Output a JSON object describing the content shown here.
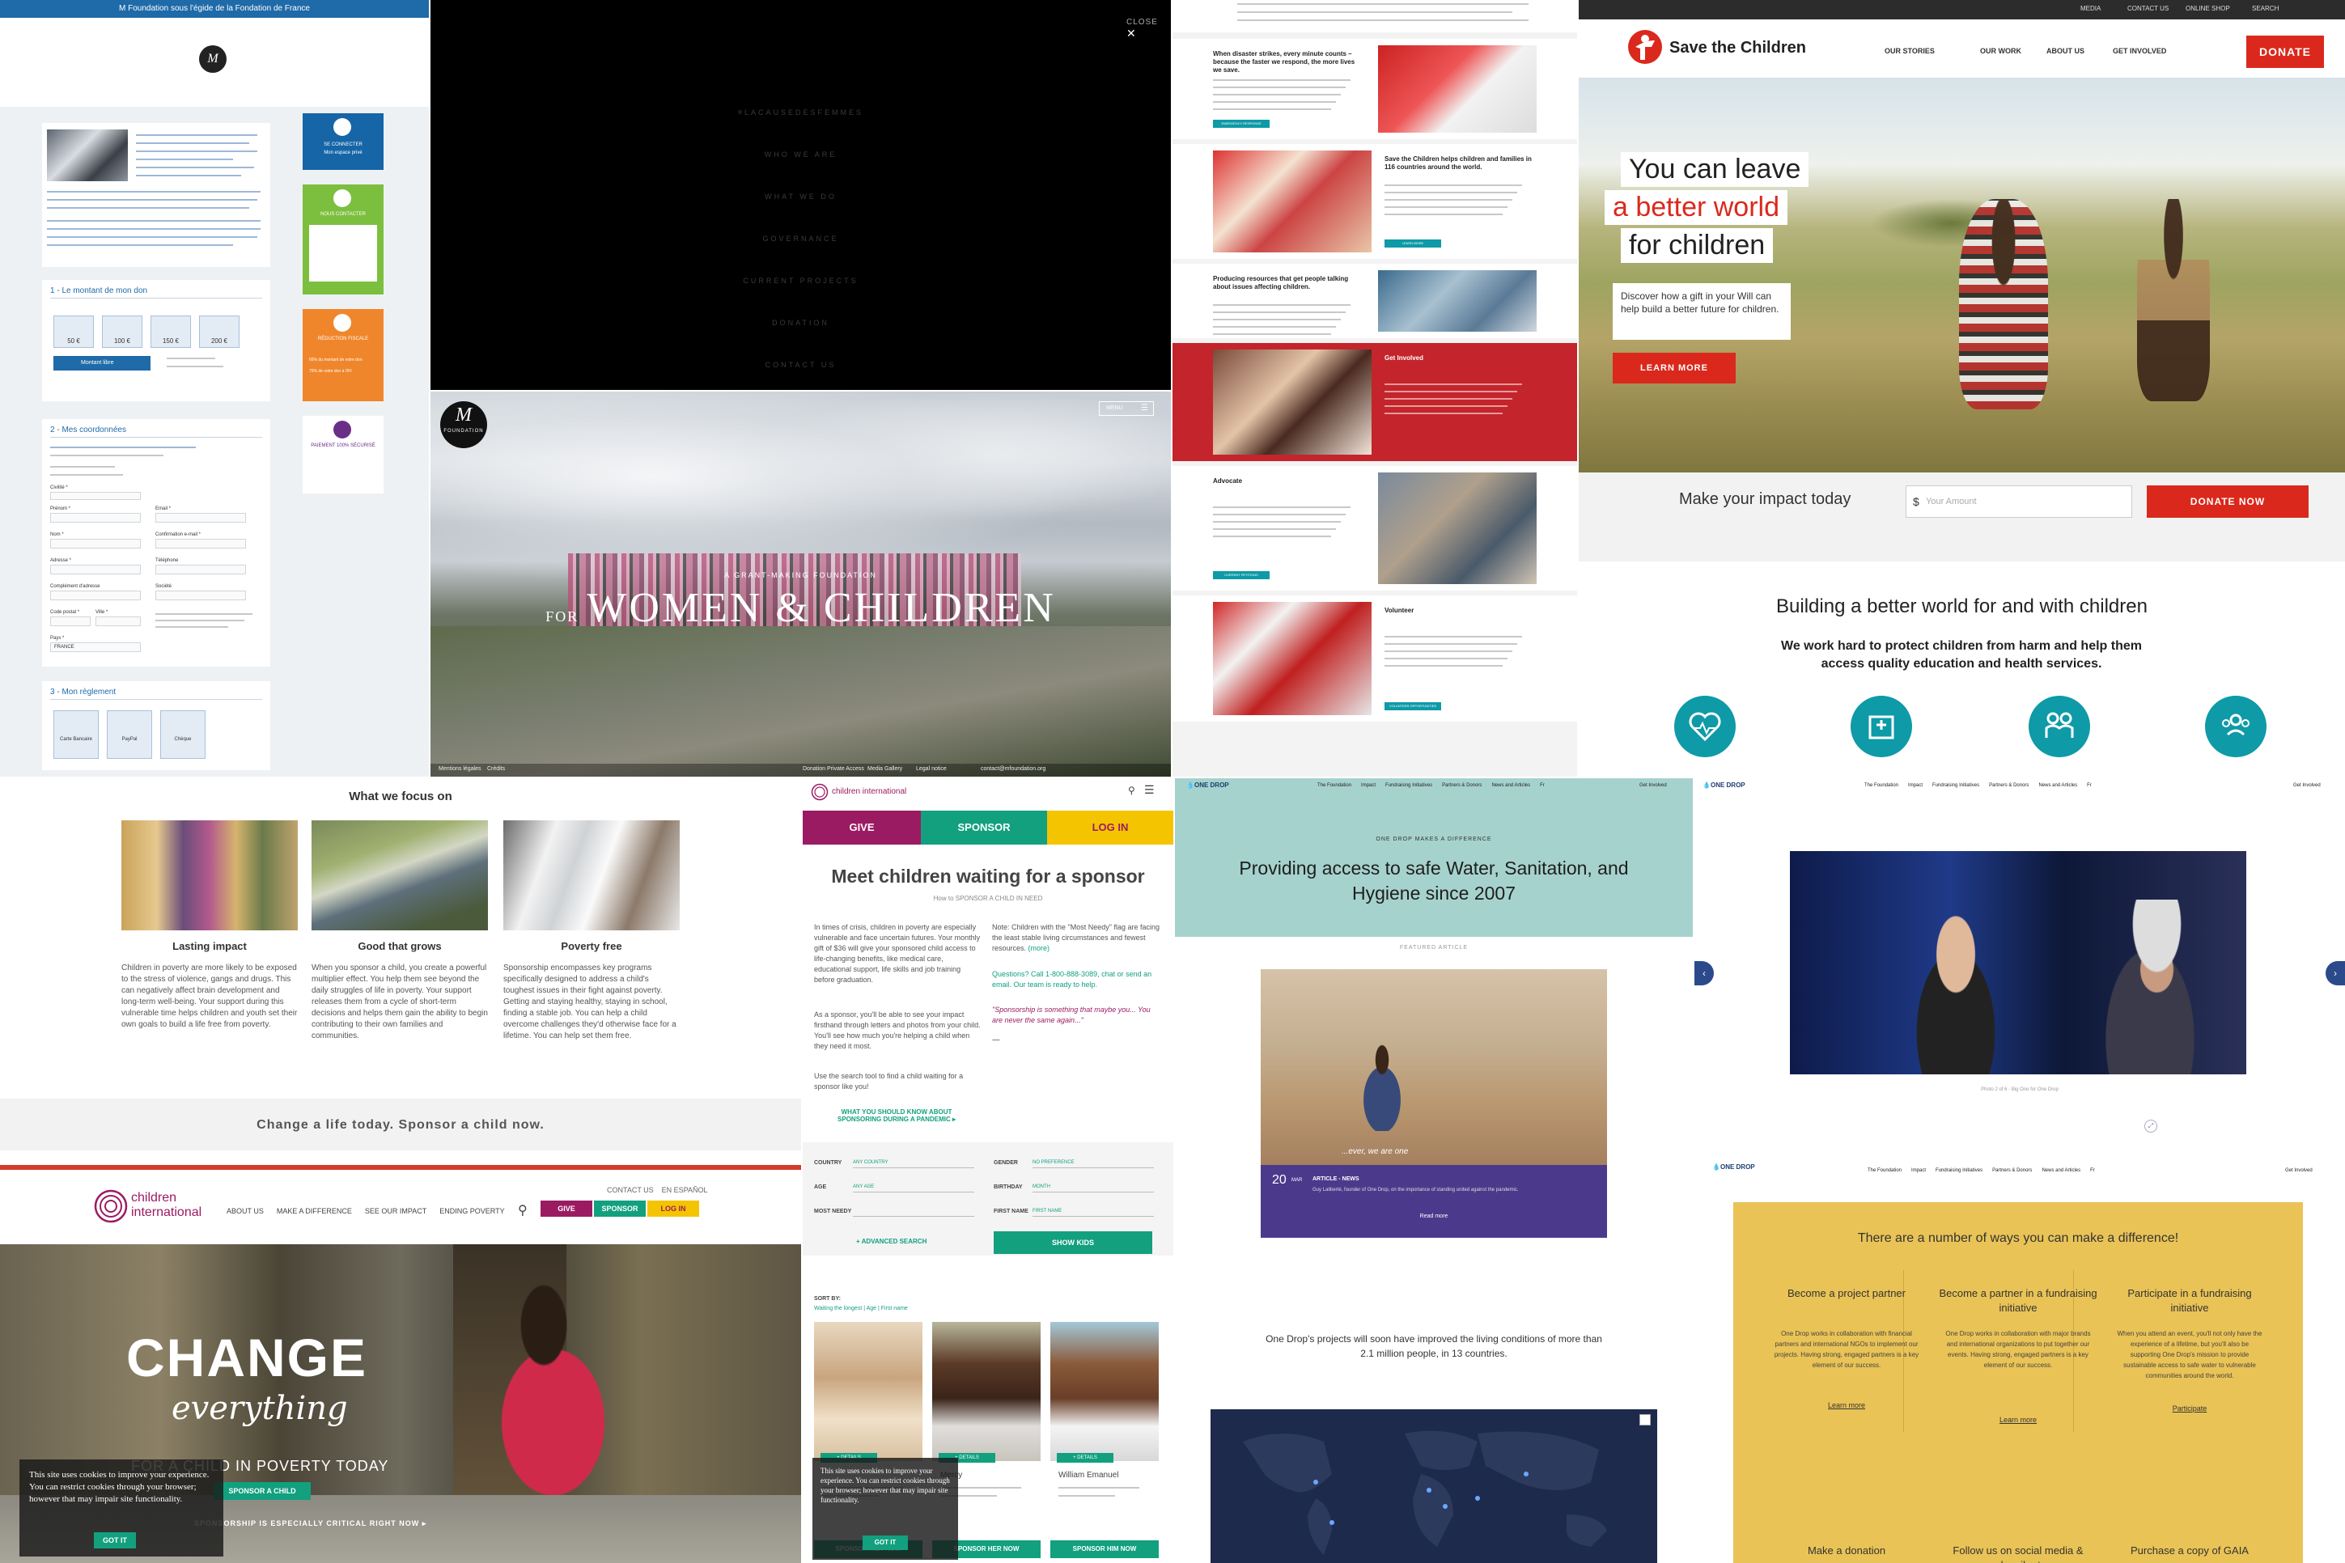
{
  "mfoundation_form": {
    "top_banner": "M Foundation sous l'égide de la Fondation de France",
    "section1_title": "1 - Le montant de mon don",
    "amounts": [
      "50 €",
      "100 €",
      "150 €",
      "200 €"
    ],
    "custom_amount_label": "Montant libre",
    "section2_title": "2 - Mes coordonnées",
    "field_labels": [
      "Civilité *",
      "Prénom *",
      "Nom *",
      "Adresse *",
      "Complément d'adresse",
      "Code postal *",
      "Ville *",
      "Pays *",
      "Email *",
      "Confirmation e-mail *",
      "Téléphone",
      "Société"
    ],
    "country_value": "FRANCE",
    "section3_title": "3 - Mon règlement",
    "payment_options": [
      "Carte Bancaire",
      "PayPal",
      "Chèque"
    ],
    "side_connect": "SE CONNECTER",
    "side_connect_sub": "Mon espace privé",
    "side_contact": "NOUS CONTACTER",
    "side_fiscal": "RÉDUCTION FISCALE",
    "side_secure": "PAIEMENT 100% SÉCURISÉ",
    "side_fiscal_items": [
      "66% du montant de votre don",
      "75% de votre don à l'IFI"
    ],
    "colors": {
      "blue": "#1565a7",
      "green": "#7cbf3e",
      "orange": "#f0862b",
      "purple": "#6a2e89"
    }
  },
  "mfoundation_menu": {
    "close_label": "CLOSE",
    "items": [
      "#LACAUSEDESFEMMES",
      "WHO WE ARE",
      "WHAT WE DO",
      "GOVERNANCE",
      "CURRENT PROJECTS",
      "DONATION",
      "CONTACT US"
    ]
  },
  "mfoundation_hero": {
    "logo_text": "FOUNDATION",
    "menu_label": "MENU",
    "kicker": "A GRANT-MAKING FOUNDATION",
    "title_for": "FOR",
    "title_main": "WOMEN & CHILDREN",
    "footer_items": [
      "Mentions légales",
      "Crédits",
      "Donation Private Access",
      "Media Gallery",
      "Legal notice",
      "contact@mfoundation.org"
    ]
  },
  "stc_australia": {
    "sections": [
      {
        "title": "When disaster strikes, every minute counts – because the faster we respond, the more lives we save.",
        "button": "EMERGENCY RESPONSE"
      },
      {
        "title": "Save the Children helps children and families in 116 countries around the world.",
        "button": "LEARN MORE"
      },
      {
        "title": "Producing resources that get people talking about issues affecting children.",
        "button": ""
      },
      {
        "title": "Get Involved",
        "button": ""
      },
      {
        "title": "Advocate",
        "button": "CURRENT PETITIONS"
      },
      {
        "title": "Volunteer",
        "button": "VOLUNTEER OPPORTUNITIES"
      }
    ]
  },
  "stc_us": {
    "util_nav": [
      "MEDIA",
      "CONTACT US",
      "ONLINE SHOP",
      "SEARCH"
    ],
    "logo": "Save the Children",
    "nav": [
      "OUR STORIES",
      "OUR WORK",
      "ABOUT US",
      "GET INVOLVED"
    ],
    "donate_label": "DONATE",
    "hero_lines": [
      "You can leave",
      "a better world",
      "for children"
    ],
    "hero_sub": "Discover how a gift in your Will can help build a better future for children.",
    "learn_more": "LEARN MORE",
    "impact_label": "Make your impact today",
    "amount_placeholder": "Your Amount",
    "currency": "$",
    "donate_now": "DONATE NOW",
    "section_title": "Building a better world for and with children",
    "section_sub": "We work hard to protect children from harm and help them access quality education and health services.",
    "brand_red": "#da291c",
    "teal": "#0e9aa7"
  },
  "ci_focus": {
    "title": "What we focus on",
    "cards": [
      {
        "title": "Lasting impact",
        "text": "Children in poverty are more likely to be exposed to the stress of violence, gangs and drugs. This can negatively affect brain development and long-term well-being. Your support during this vulnerable time helps children and youth set their own goals to build a life free from poverty."
      },
      {
        "title": "Good that grows",
        "text": "When you sponsor a child, you create a powerful multiplier effect. You help them see beyond the daily struggles of life in poverty. Your support releases them from a cycle of short-term decisions and helps them gain the ability to begin contributing to their own families and communities."
      },
      {
        "title": "Poverty free",
        "text": "Sponsorship encompasses key programs specifically designed to address a child's toughest issues in their fight against poverty. Getting and staying healthy, staying in school, finding a stable job. You can help a child overcome challenges they'd otherwise face for a lifetime. You can help set them free."
      }
    ],
    "cta": "Change a life today. Sponsor a child now."
  },
  "ci_home": {
    "logo_line1": "children",
    "logo_line2": "international",
    "top_links": [
      "CONTACT US",
      "EN ESPAÑOL"
    ],
    "nav": [
      "ABOUT US",
      "MAKE A DIFFERENCE",
      "SEE OUR IMPACT",
      "ENDING POVERTY"
    ],
    "give": "GIVE",
    "sponsor": "SPONSOR",
    "login": "LOG IN",
    "hero_big": "CHANGE",
    "hero_script": "everything",
    "hero_line": "FOR A CHILD IN POVERTY TODAY",
    "sponsor_btn": "SPONSOR A CHILD",
    "hero_foot": "SPONSORSHIP IS ESPECIALLY CRITICAL RIGHT NOW ▸",
    "cookie_text": "This site uses cookies to improve your experience. You can restrict cookies through your browser; however that may impair site functionality.",
    "got_it": "GOT IT",
    "colors": {
      "magenta": "#9b1b63",
      "green": "#12a07f",
      "yellow": "#f5c400"
    }
  },
  "ci_mobile": {
    "logo": "children international",
    "give": "GIVE",
    "sponsor": "SPONSOR",
    "login": "LOG IN",
    "title": "Meet children waiting for a sponsor",
    "how_to": "How to SPONSOR A CHILD IN NEED",
    "p1": "In times of crisis, children in poverty are especially vulnerable and face uncertain futures. Your monthly gift of $36 will give your sponsored child access to life-changing benefits, like medical care, educational support, life skills and job training before graduation.",
    "p2": "As a sponsor, you'll be able to see your impact firsthand through letters and photos from your child. You'll see how much you're helping a child when they need it most.",
    "p3": "Use the search tool to find a child waiting for a sponsor like you!",
    "note": "Note: Children with the \"Most Needy\" flag are facing the least stable living circumstances and fewest resources.",
    "more": "(more)",
    "questions": "Questions? Call 1-800-888-3089, chat or send an email. Our team is ready to help.",
    "quote": "\"Sponsorship is something that maybe you... You are never the same again...\"",
    "pandemic_link": "WHAT YOU SHOULD KNOW ABOUT SPONSORING DURING A PANDEMIC ▸",
    "filters": [
      {
        "label": "COUNTRY",
        "value": "ANY COUNTRY"
      },
      {
        "label": "GENDER",
        "value": "NO PREFERENCE"
      },
      {
        "label": "AGE",
        "value": "ANY AGE"
      },
      {
        "label": "BIRTHDAY",
        "value": "MONTH"
      },
      {
        "label": "MOST NEEDY",
        "value": ""
      },
      {
        "label": "FIRST NAME",
        "value": "FIRST NAME"
      }
    ],
    "advanced": "+ ADVANCED SEARCH",
    "show_kids": "SHOW KIDS",
    "sort_by": "SORT BY:",
    "sort_options": "Waiting the longest | Age | First name",
    "kids": [
      {
        "name": "",
        "btn": "SPONSOR HER NOW"
      },
      {
        "name": "Mercy",
        "btn": "SPONSOR HER NOW"
      },
      {
        "name": "William Emanuel",
        "btn": "SPONSOR HIM NOW"
      }
    ],
    "details": "+ DETAILS",
    "cookie_text": "This site uses cookies to improve your experience. You can restrict cookies through your browser; however that may impair site functionality.",
    "got_it": "GOT IT"
  },
  "onedrop_home": {
    "logo": "ONE DROP",
    "nav": [
      "The Foundation",
      "Impact",
      "Fundraising Initiatives",
      "Partners & Donors",
      "News and Articles",
      "Fr"
    ],
    "get_involved": "Get Involved",
    "kicker": "ONE DROP MAKES A DIFFERENCE",
    "title": "Providing access to safe Water, Sanitation, and Hygiene since 2007",
    "featured": "FEATURED ARTICLE",
    "article_day": "20",
    "article_month": "MAR",
    "article_tag": "ARTICLE - NEWS",
    "article_text": "Guy Laliberté, founder of One Drop, on the importance of standing united against the pandemic.",
    "overlay_caption": "...ever, we are one",
    "read_more": "Read more",
    "impact_text": "One Drop's projects will soon have improved the living conditions of more than 2.1 million people, in 13 countries.",
    "bg": "#a6d2cd",
    "purple": "#4b3a8c"
  },
  "onedrop_gallery": {
    "caption": "Photo 2 of 6 - Big One for One Drop"
  },
  "onedrop_ways": {
    "title": "There are a number of ways you can make a difference!",
    "cols": [
      {
        "title": "Become a project partner",
        "text": "One Drop works in collaboration with financial partners and international NGOs to implement our projects. Having strong, engaged partners is a key element of our success.",
        "link": "Learn more"
      },
      {
        "title": "Become a partner in a fundraising initiative",
        "text": "One Drop works in collaboration with major brands and international organizations to put together our events. Having strong, engaged partners is a key element of our success.",
        "link": "Learn more"
      },
      {
        "title": "Participate in a fundraising initiative",
        "text": "When you attend an event, you'll not only have the experience of a lifetime, but you'll also be supporting One Drop's mission to provide sustainable access to safe water to vulnerable communities around the world.",
        "link": "Participate"
      }
    ],
    "bottom": [
      "Make a donation",
      "Follow us on social media & subscribe to",
      "Purchase a copy of GAIA"
    ],
    "bg": "#e9c356"
  }
}
